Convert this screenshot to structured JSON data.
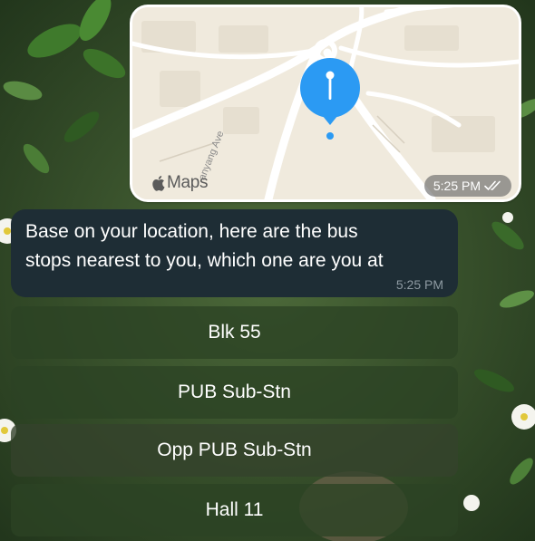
{
  "map_message": {
    "road_label": "anyang Ave",
    "maps_brand": "Maps",
    "time": "5:25 PM",
    "read_status_icon": "double-check-icon"
  },
  "text_message": {
    "line1": "Base on your location, here are the bus",
    "line2": "stops nearest to you, which one are you at",
    "time": "5:25 PM"
  },
  "reply_buttons": [
    {
      "label": "Blk 55"
    },
    {
      "label": "PUB Sub-Stn"
    },
    {
      "label": "Opp PUB Sub-Stn"
    },
    {
      "label": "Hall 11"
    }
  ],
  "colors": {
    "pin_blue": "#2b9af3",
    "message_bubble": "#1e2d35",
    "button_green": "#2c4224"
  }
}
